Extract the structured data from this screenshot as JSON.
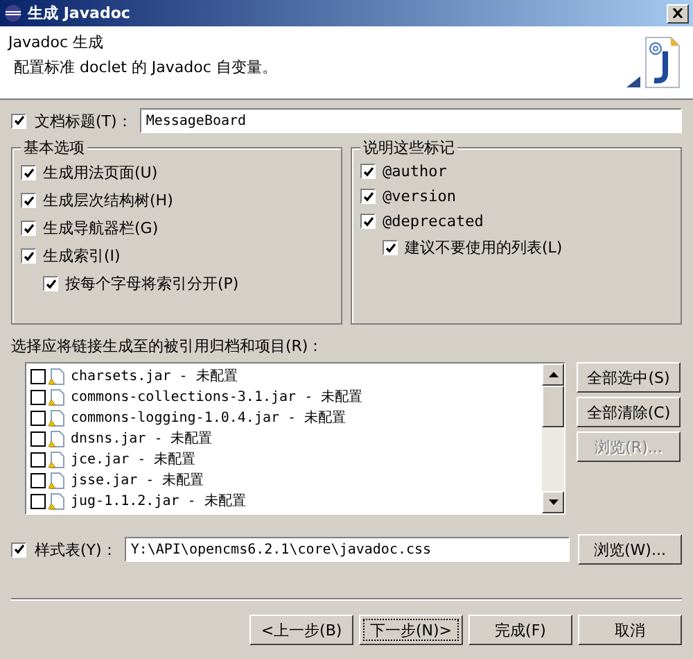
{
  "window": {
    "title": "生成 Javadoc"
  },
  "header": {
    "title": "Javadoc 生成",
    "description": "配置标准 doclet 的 Javadoc 自变量。"
  },
  "doc_title": {
    "label": "文档标题(T)：",
    "checked": true,
    "value": "MessageBoard"
  },
  "basic_options": {
    "title": "基本选项",
    "items": [
      {
        "label": "生成用法页面(U)",
        "checked": true
      },
      {
        "label": "生成层次结构树(H)",
        "checked": true
      },
      {
        "label": "生成导航器栏(G)",
        "checked": true
      },
      {
        "label": "生成索引(I)",
        "checked": true,
        "children": [
          {
            "label": "按每个字母将索引分开(P)",
            "checked": true
          }
        ]
      }
    ]
  },
  "tags": {
    "title": "说明这些标记",
    "items": [
      {
        "label": "@author",
        "checked": true
      },
      {
        "label": "@version",
        "checked": true
      },
      {
        "label": "@deprecated",
        "checked": true,
        "children": [
          {
            "label": "建议不要使用的列表(L)",
            "checked": true
          }
        ]
      }
    ]
  },
  "references": {
    "label": "选择应将链接生成至的被引用归档和项目(R)：",
    "items": [
      {
        "label": "charsets.jar - 未配置",
        "checked": false
      },
      {
        "label": "commons-collections-3.1.jar - 未配置",
        "checked": false
      },
      {
        "label": "commons-logging-1.0.4.jar - 未配置",
        "checked": false
      },
      {
        "label": "dnsns.jar - 未配置",
        "checked": false
      },
      {
        "label": "jce.jar - 未配置",
        "checked": false
      },
      {
        "label": "jsse.jar - 未配置",
        "checked": false
      },
      {
        "label": "jug-1.1.2.jar - 未配置",
        "checked": false
      }
    ],
    "buttons": [
      {
        "label": "全部选中(S)",
        "disabled": false
      },
      {
        "label": "全部清除(C)",
        "disabled": false
      },
      {
        "label": "浏览(R)...",
        "disabled": true
      }
    ]
  },
  "stylesheet": {
    "label": "样式表(Y)：",
    "checked": true,
    "value": "Y:\\API\\opencms6.2.1\\core\\javadoc.css",
    "button": "浏览(W)..."
  },
  "footer": {
    "buttons": [
      {
        "label": "<上一步(B)",
        "focused": false
      },
      {
        "label": "下一步(N)>",
        "focused": true
      },
      {
        "label": "完成(F)",
        "focused": false
      },
      {
        "label": "取消",
        "focused": false
      }
    ]
  }
}
